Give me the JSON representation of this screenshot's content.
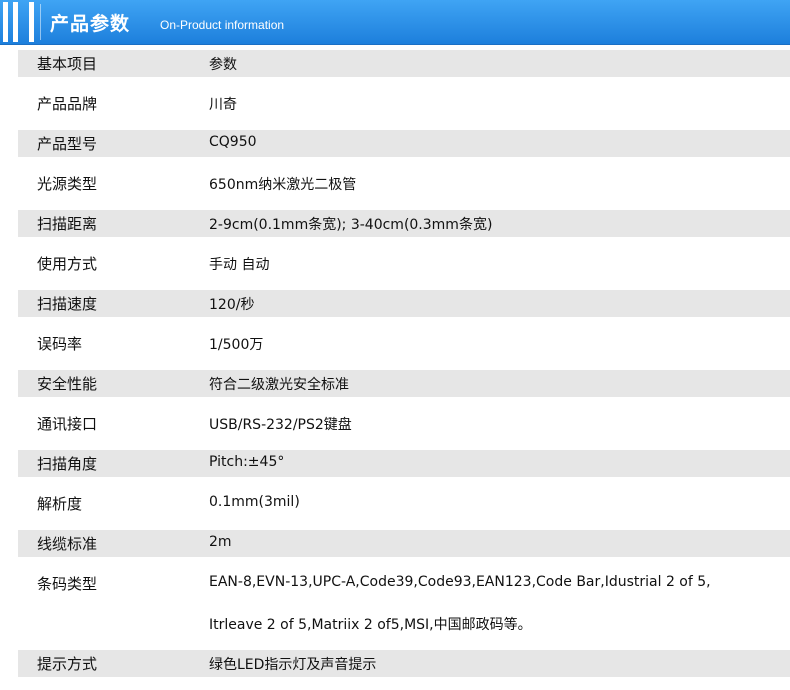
{
  "header": {
    "title_cn": "产品参数",
    "title_en": "On-Product information"
  },
  "table": {
    "rows": [
      {
        "label": "基本项目",
        "value": "参数"
      },
      {
        "label": "产品品牌",
        "value": "川奇"
      },
      {
        "label": "产品型号",
        "value": "CQ950"
      },
      {
        "label": "光源类型",
        "value": "650nm纳米激光二极管"
      },
      {
        "label": "扫描距离",
        "value": "2-9cm(0.1mm条宽); 3-40cm(0.3mm条宽)"
      },
      {
        "label": "使用方式",
        "value": "手动 自动"
      },
      {
        "label": "扫描速度",
        "value": "120/秒"
      },
      {
        "label": "误码率",
        "value": "1/500万"
      },
      {
        "label": "安全性能",
        "value": "符合二级激光安全标准"
      },
      {
        "label": "通讯接口",
        "value": "USB/RS-232/PS2键盘"
      },
      {
        "label": "扫描角度",
        "value": "Pitch:±45°"
      },
      {
        "label": "解析度",
        "value": "0.1mm(3mil)"
      },
      {
        "label": "线缆标准",
        "value": "2m"
      },
      {
        "label": "条码类型",
        "value": "EAN-8,EVN-13,UPC-A,Code39,Code93,EAN123,Code Bar,Idustrial 2 of 5,",
        "value2": "Itrleave 2 of 5,Matriix 2 of5,MSI,中国邮政码等。"
      },
      {
        "label": "提示方式",
        "value": "绿色LED指示灯及声音提示"
      }
    ]
  }
}
